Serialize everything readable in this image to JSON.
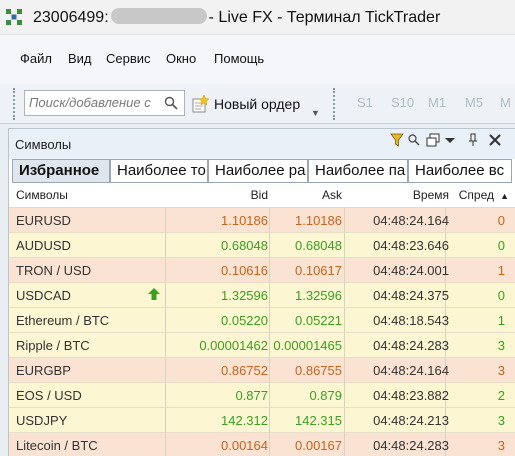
{
  "window": {
    "account": "23006499:",
    "title_suffix": "- Live FX - Терминал TickTrader"
  },
  "menu": [
    "Файл",
    "Вид",
    "Сервис",
    "Окно",
    "Помощь"
  ],
  "toolbar": {
    "search_placeholder": "Поиск/добавление с",
    "new_order_label": "Новый ордер",
    "timeframes": [
      "S1",
      "S10",
      "M1",
      "M5",
      "M"
    ]
  },
  "panel": {
    "title": "Символы",
    "tabs": [
      "Избранное",
      "Наиболее то",
      "Наиболее ра",
      "Наиболее па",
      "Наиболее вс"
    ],
    "columns": {
      "symbol": "Символы",
      "bid": "Bid",
      "ask": "Ask",
      "time": "Время",
      "spread": "Спред",
      "sort_indicator": "▲"
    }
  },
  "colors": {
    "up": "#3aa120",
    "down": "#c7641a",
    "row_up_bg": "#fcf6d2",
    "row_down_bg": "#fbe3d4"
  },
  "rows": [
    {
      "symbol": "EURUSD",
      "bid": "1.10186",
      "ask": "1.10186",
      "time": "04:48:24.164",
      "spread": "0",
      "dir": "down",
      "arrow": false
    },
    {
      "symbol": "AUDUSD",
      "bid": "0.68048",
      "ask": "0.68048",
      "time": "04:48:23.646",
      "spread": "0",
      "dir": "up",
      "arrow": false
    },
    {
      "symbol": "TRON / USD",
      "bid": "0.10616",
      "ask": "0.10617",
      "time": "04:48:24.001",
      "spread": "1",
      "dir": "down",
      "arrow": false
    },
    {
      "symbol": "USDCAD",
      "bid": "1.32596",
      "ask": "1.32596",
      "time": "04:48:24.375",
      "spread": "0",
      "dir": "up",
      "arrow": true
    },
    {
      "symbol": "Ethereum / BTC",
      "bid": "0.05220",
      "ask": "0.05221",
      "time": "04:48:18.543",
      "spread": "1",
      "dir": "up",
      "arrow": false
    },
    {
      "symbol": "Ripple / BTC",
      "bid": "0.00001462",
      "ask": "0.00001465",
      "time": "04:48:24.283",
      "spread": "3",
      "dir": "up",
      "arrow": false
    },
    {
      "symbol": "EURGBP",
      "bid": "0.86752",
      "ask": "0.86755",
      "time": "04:48:24.164",
      "spread": "3",
      "dir": "down",
      "arrow": false
    },
    {
      "symbol": "EOS / USD",
      "bid": "0.877",
      "ask": "0.879",
      "time": "04:48:23.882",
      "spread": "2",
      "dir": "up",
      "arrow": false
    },
    {
      "symbol": "USDJPY",
      "bid": "142.312",
      "ask": "142.315",
      "time": "04:48:24.213",
      "spread": "3",
      "dir": "up",
      "arrow": false
    },
    {
      "symbol": "Litecoin / BTC",
      "bid": "0.00164",
      "ask": "0.00167",
      "time": "04:48:24.283",
      "spread": "3",
      "dir": "down",
      "arrow": false
    }
  ]
}
